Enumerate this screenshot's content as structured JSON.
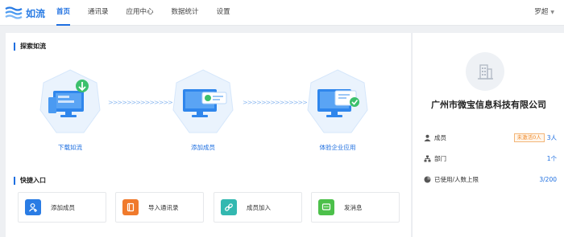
{
  "app": {
    "name": "如流"
  },
  "nav": {
    "items": [
      {
        "label": "首页",
        "active": true
      },
      {
        "label": "通讯录",
        "active": false
      },
      {
        "label": "应用中心",
        "active": false
      },
      {
        "label": "数据统计",
        "active": false
      },
      {
        "label": "设置",
        "active": false
      }
    ],
    "user": "罗超"
  },
  "explore": {
    "title": "探索如流",
    "steps": [
      {
        "label": "下载如流",
        "icon": "download-computer-icon"
      },
      {
        "label": "添加成员",
        "icon": "add-member-computer-icon"
      },
      {
        "label": "体验企业应用",
        "icon": "enterprise-app-computer-icon"
      }
    ],
    "arrows": ">>>>>>>>>>>>>>"
  },
  "quick": {
    "title": "快捷入口",
    "items": [
      {
        "label": "添加成员",
        "icon": "add-user-icon",
        "color": "#2a7ce4"
      },
      {
        "label": "导入通讯录",
        "icon": "import-contacts-icon",
        "color": "#f07a2c"
      },
      {
        "label": "成员加入",
        "icon": "link-icon",
        "color": "#33b8b0"
      },
      {
        "label": "发消息",
        "icon": "message-icon",
        "color": "#4cc04a"
      }
    ]
  },
  "company": {
    "name": "广州市微宝信息科技有限公司",
    "logo_icon": "building-icon",
    "members_label": "成员",
    "inactive_badge": "未激活0人",
    "members_value": "3人",
    "departments_label": "部门",
    "departments_value": "1个",
    "usage_label": "已使用/人数上限",
    "usage_value": "3/200"
  },
  "colors": {
    "accent": "#1e6fe0",
    "badge": "#f08c2e"
  }
}
